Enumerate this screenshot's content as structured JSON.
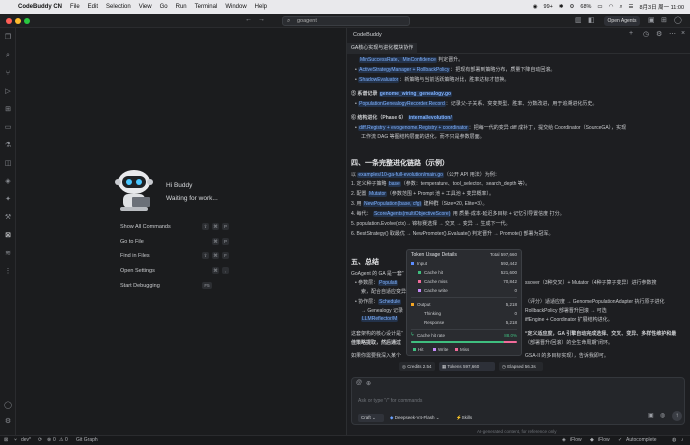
{
  "menubar": {
    "app": "CodeBuddy CN",
    "items": [
      "File",
      "Edit",
      "Selection",
      "View",
      "Go",
      "Run",
      "Terminal",
      "Window",
      "Help"
    ],
    "status_count": "99+",
    "battery": "68%",
    "datetime": "8月3日 周一 11:00"
  },
  "titlebar": {
    "search_value": "goagent",
    "open_agents": "Open Agents"
  },
  "welcome": {
    "greeting": "Hi Buddy",
    "status": "Waiting for work...",
    "commands": [
      {
        "label": "Show All Commands",
        "keys": [
          "⇧",
          "⌘",
          "P"
        ]
      },
      {
        "label": "Go to File",
        "keys": [
          "⌘",
          "P"
        ]
      },
      {
        "label": "Find in Files",
        "keys": [
          "⇧",
          "⌘",
          "F"
        ]
      },
      {
        "label": "Open Settings",
        "keys": [
          "⌘",
          ","
        ]
      },
      {
        "label": "Start Debugging",
        "keys": [
          "F5"
        ]
      }
    ]
  },
  "panel": {
    "title": "CodeBuddy",
    "tab": "GA核心实现与进化模块协作",
    "lines": {
      "l1_code": "MinSuccessRate、MinConfidence",
      "l1_text": "判定晋升。",
      "b1_code": "ActiveStrategyManager + RollbackPolicy",
      "b1_text": "：把现有部署到策略分布，质量下降自动回滚。",
      "b2_code": "ShadowEvaluator",
      "b2_text": "：新策略与当前活跃策略对比，胜率达标才替换。",
      "s1_title": "⑤ 系谱记录",
      "s1_code": "genome_wiring_genealogy.go",
      "s1b_code": "PopulationGenealogyRecorder.Record",
      "s1b_text": "：记录父-子关系、突变类型、胜率、分数改进，用于追溯进化历史。",
      "s2_title": "⑥ 结构进化（Phase 6）",
      "s2_code": "internal/evolution/",
      "s2b_code": "diff.Registry + evogenome.Registry + coordinator",
      "s2b_text": "：把每一代的变异 diff 成补丁，提交给 Coordinator（SourceGA），实现",
      "s2c_text": "工作流 DAG 等图结构层面的进化，而不只是参数层面。",
      "sec4": "四、一条完整进化链路（示例）",
      "sec4_intro_a": "以",
      "sec4_intro_code": "examples/10-ga-full-evolution/main.go",
      "sec4_intro_b": "（公开 API 用法）为例：",
      "o1_a": "1. 定义种子策略",
      "o1_code": "base",
      "o1_b": "（参数：temperature、tool_selector、search_depth 等）。",
      "o2_a": "2. 配置",
      "o2_code": "Mutator",
      "o2_b": "（参数范围 + Prompt 池 + 工具池 + 变异概率）。",
      "o3_a": "3. 用",
      "o3_code": "NewPopulation(base, cfg)",
      "o3_b": "建种群（Size=20, Elite=3）。",
      "o4_a": "4. 每代：",
      "o4_code": "ScoreAgents(multiObjectiveScore)",
      "o4_b": "用 质量-成本-延迟多目标 + 记忆引导置信度 打分。",
      "o5_code": "5. population.Evolve(ctx)",
      "o5_b": "→ 锦标赛选择 → 交叉 → 变异 → 生成下一代。",
      "o6_code": "6. BestStrategy()",
      "o6_b": "取最优 → NewPromoter().Evaluate() 判定晋升 → Promote() 部署为冠军。",
      "sec5": "五、总结",
      "sum1": "GoAgent 的 GA 是一套“",
      "sum2_a": "• 参数层：",
      "sum2_code": "Populati",
      "sum2_b": "ssover（3种交叉）+ Mutator（4种子算子变异）进行参数搜",
      "sum2c": "索，配合自适应变异",
      "sum3_a": "• 协作层：",
      "sum3_code": "Schedule",
      "sum3_b": "（评分）适适应度 → GenomePopulationAdapter 执行原子进化",
      "sum3c_a": "→ Genealogy 记录",
      "sum3c_b": "RollbackPolicy 部署晋升回滚 → 可选",
      "sum3d_code": "LLMReflector/M",
      "sum3d_b": "iffEngine + Coordinator 扩展结构进化。",
      "sum4": "这套架构的核心设计是“",
      "sum4_b": "“定义适应度，GA 引擎自动完成选择、交叉、变异、多样性维护和最",
      "sum5": "佳策略提取，然后通过",
      "sum5_b": "（部署晋升/回滚）的全生命周期”闭环。",
      "sum6": "如果你需要我深入某个",
      "sum6_b": "GSA-II 的多目标实现），告诉我即可。"
    },
    "metrics": {
      "credits_label": "Credits",
      "credits": "2.54",
      "tokens_label": "Tokens",
      "tokens": "597,660",
      "elapsed_label": "Elapsed",
      "elapsed": "56.3s"
    },
    "input_placeholder": "Ask or type \"/\" for commands",
    "mode": "Craft",
    "model": "Deepseek-V4-Flash",
    "skills": "Skills",
    "disclaimer": "AI-generated content, for reference only"
  },
  "token_popup": {
    "title": "Token Usage Details",
    "total_label": "Total",
    "total": "597,660",
    "input_label": "Input",
    "input": "592,442",
    "cache_hit_label": "Cache hit",
    "cache_hit": "521,600",
    "cache_miss_label": "Cache miss",
    "cache_miss": "70,842",
    "cache_write_label": "Cache write",
    "cache_write": "0",
    "output_label": "Output",
    "output": "5,218",
    "thinking_label": "Thinking",
    "thinking": "0",
    "response_label": "Response",
    "response": "5,218",
    "hit_rate_label": "Cache hit rate",
    "hit_rate": "88.0%",
    "hit_rate_fraction": 0.88,
    "legend": [
      "Hit",
      "Write",
      "Miss"
    ],
    "colors": {
      "hit": "#3fbf7f",
      "write": "#c58af9",
      "miss": "#f16b9a"
    }
  },
  "statusbar": {
    "branch": "dev*",
    "errors": "0",
    "warnings": "0",
    "graph": "Git Graph",
    "flow": "iFlow",
    "flow_cn": "iFlow",
    "autocomplete": "Autocomplete"
  }
}
